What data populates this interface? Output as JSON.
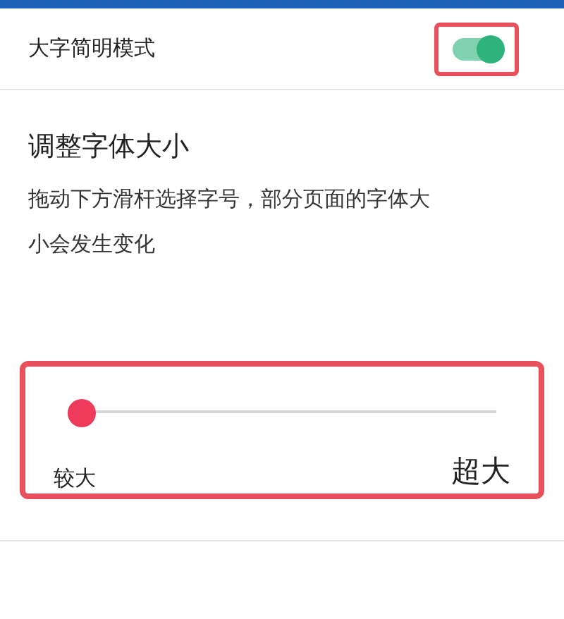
{
  "settings": {
    "large_text_mode": {
      "label": "大字简明模式",
      "on": true
    }
  },
  "font_size": {
    "title": "调整字体大小",
    "description": "拖动下方滑杆选择字号，部分页面的字体大小会发生变化",
    "slider": {
      "level": 0,
      "min_label": "较大",
      "max_label": "超大"
    }
  }
}
